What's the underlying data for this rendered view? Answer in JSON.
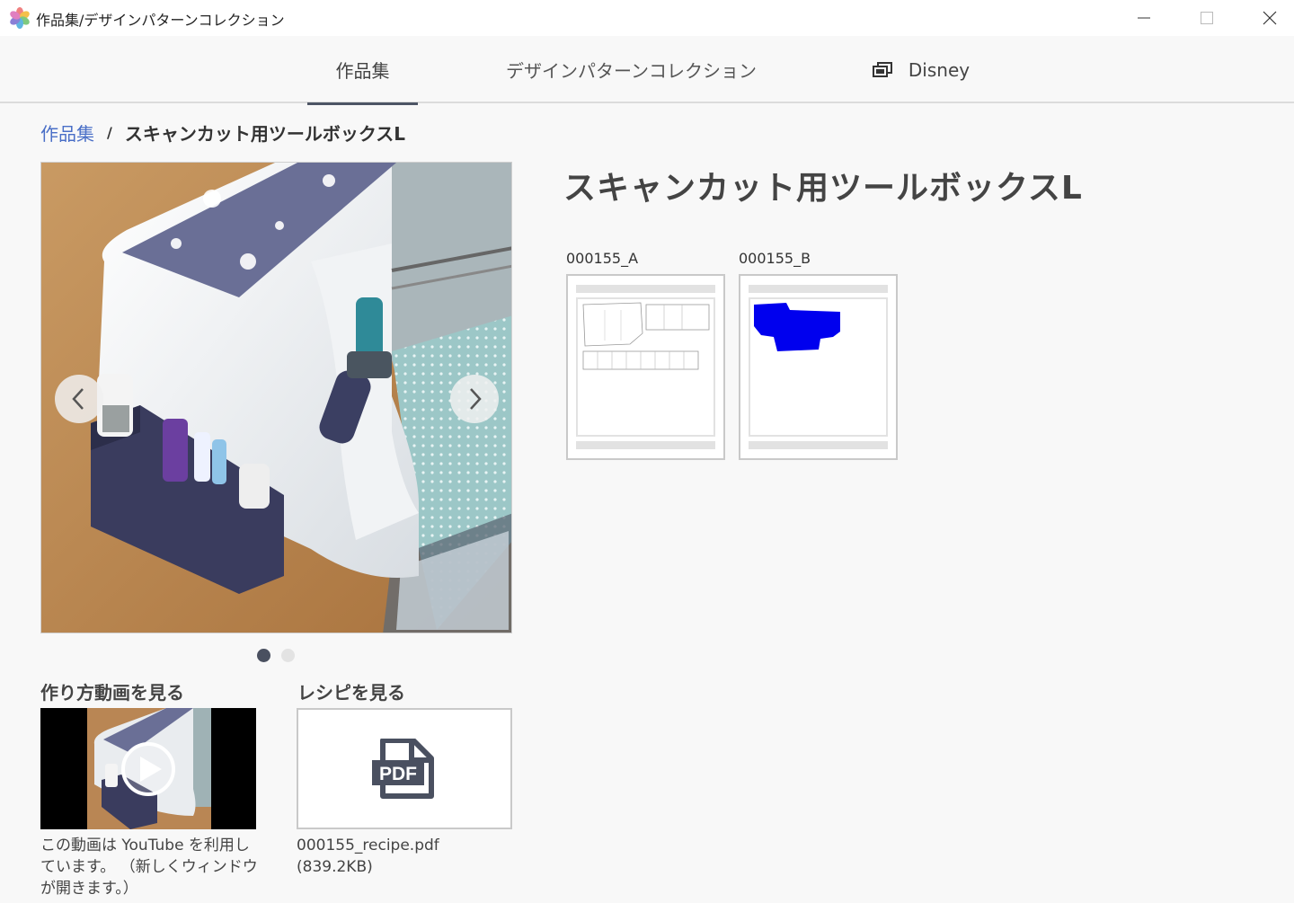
{
  "window": {
    "title": "作品集/デザインパターンコレクション"
  },
  "tabs": [
    {
      "label": "作品集",
      "active": true
    },
    {
      "label": "デザインパターンコレクション",
      "active": false
    },
    {
      "label": "Disney",
      "active": false,
      "icon": "window-stack-icon"
    }
  ],
  "breadcrumb": {
    "root": "作品集",
    "separator": "/",
    "current": "スキャンカット用ツールボックスL"
  },
  "product": {
    "title": "スキャンカット用ツールボックスL",
    "carousel": {
      "slides": 2,
      "active_index": 0
    }
  },
  "patterns": [
    {
      "label": "000155_A"
    },
    {
      "label": "000155_B"
    }
  ],
  "video": {
    "heading": "作り方動画を見る",
    "description": "この動画は YouTube を利用しています。 （新しくウィンドウが開きます。）"
  },
  "recipe": {
    "heading": "レシピを見る",
    "icon_text": "PDF",
    "file_name": "000155_recipe.pdf",
    "file_size": "(839.2KB)"
  },
  "colors": {
    "accent_link": "#4a6fc7",
    "tab_indicator": "#4d5565",
    "pattern_b_fill": "#0000ee"
  }
}
